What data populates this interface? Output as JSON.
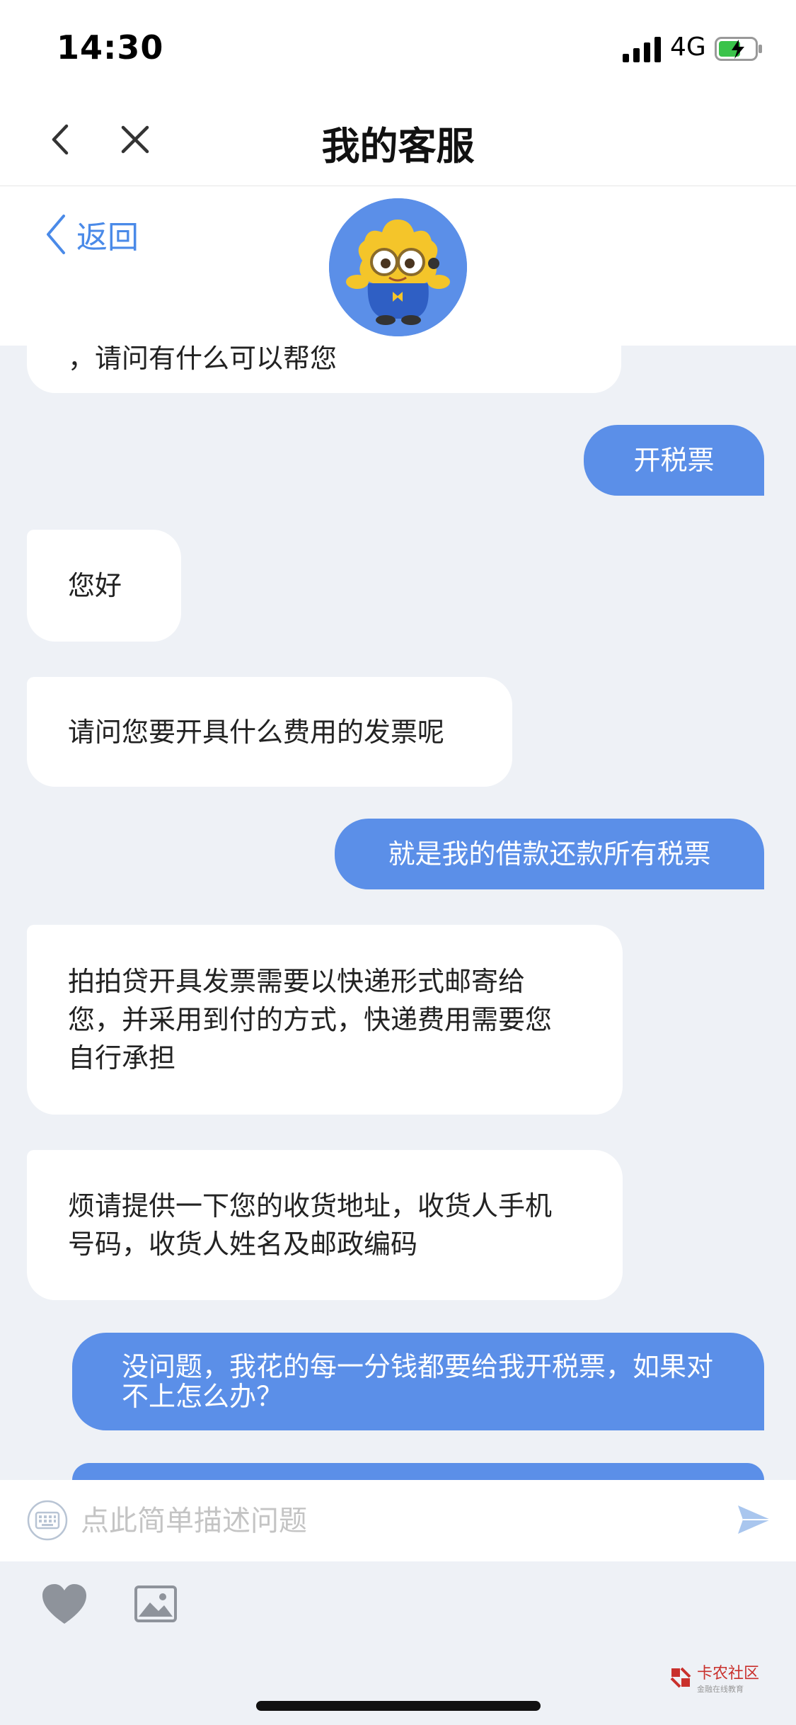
{
  "status_bar": {
    "time": "14:30",
    "network": "4G",
    "battery_level": 0.6
  },
  "nav": {
    "title": "我的客服"
  },
  "chat_header": {
    "back_label": "返回"
  },
  "messages": [
    {
      "side": "left",
      "text": "，请问有什么可以帮您"
    },
    {
      "side": "right",
      "text": "开税票"
    },
    {
      "side": "left",
      "text": "您好"
    },
    {
      "side": "left",
      "text": "请问您要开具什么费用的发票呢"
    },
    {
      "side": "right",
      "text": "就是我的借款还款所有税票"
    },
    {
      "side": "left",
      "text": "拍拍贷开具发票需要以快递形式邮寄给您，并采用到付的方式，快递费用需要您自行承担"
    },
    {
      "side": "left",
      "text": "烦请提供一下您的收货地址，收货人手机号码，收货人姓名及邮政编码"
    },
    {
      "side": "right",
      "text": "没问题，我花的每一分钱都要给我开税票，如果对不上怎么办？"
    },
    {
      "side": "right",
      "text": ""
    }
  ],
  "input": {
    "placeholder": "点此简单描述问题"
  },
  "watermark": {
    "name": "卡农社区",
    "tagline": "金融在线教育"
  },
  "colors": {
    "accent": "#5b8fe8",
    "link": "#4a8ae8",
    "background": "#eef1f6",
    "bubble_left": "#ffffff"
  },
  "icons": [
    "signal-icon",
    "battery-icon",
    "back-chevron-icon",
    "close-icon",
    "keyboard-icon",
    "send-icon",
    "heart-icon",
    "image-icon"
  ]
}
